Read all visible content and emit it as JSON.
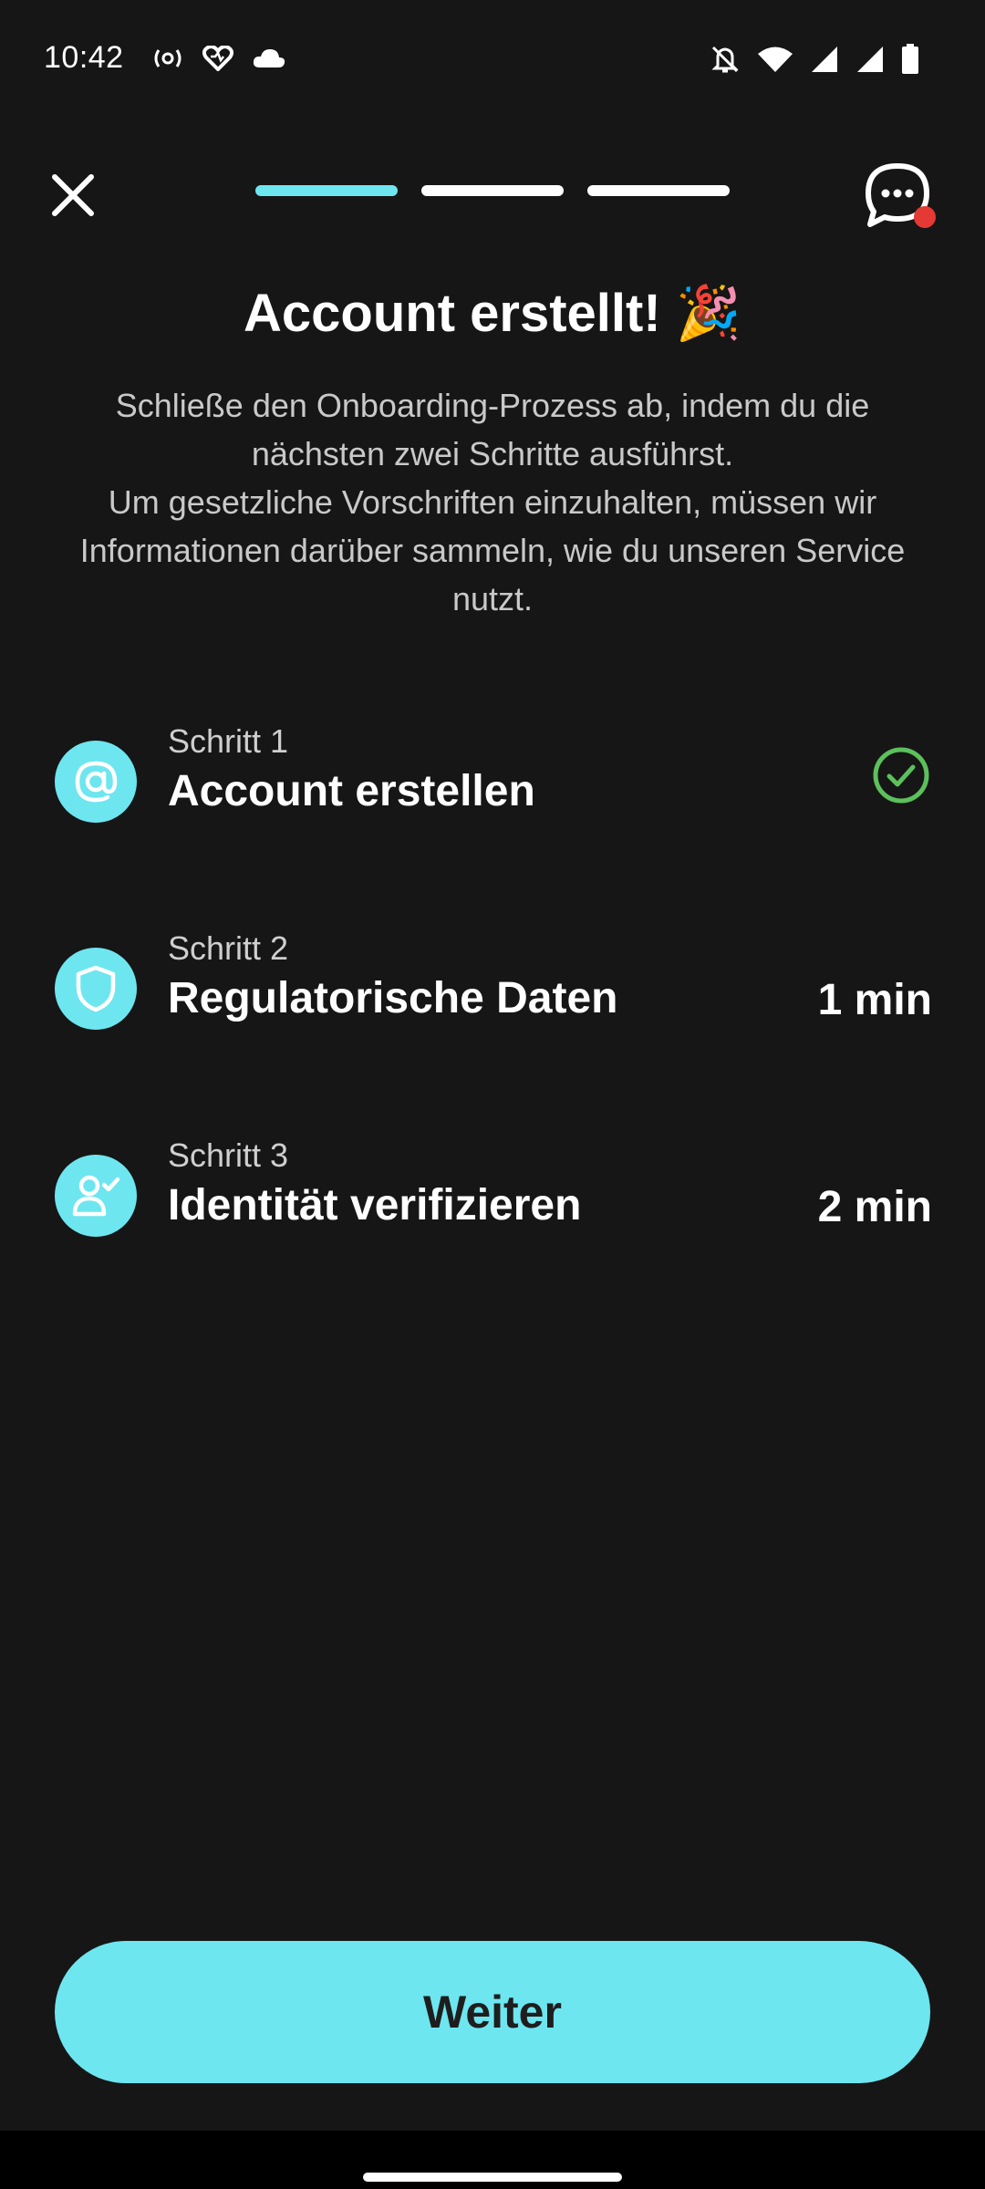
{
  "status_bar": {
    "time": "10:42",
    "left_icons": [
      "radio-icon",
      "heart-icon",
      "cloud-icon"
    ],
    "right_icons": [
      "bell-off-icon",
      "wifi-icon",
      "signal-icon",
      "signal-icon",
      "battery-icon"
    ]
  },
  "header": {
    "progress": {
      "total_steps": 3,
      "active_step": 1
    },
    "close_icon": "close-icon",
    "chat_icon": "chat-icon",
    "chat_notification": true
  },
  "main": {
    "title": "Account erstellt! 🎉",
    "description": [
      "Schließe den Onboarding-Prozess ab, indem du die nächsten zwei Schritte ausführst.",
      "Um gesetzliche Vorschriften einzuhalten, müssen wir Informationen darüber sammeln, wie du unseren Service nutzt."
    ],
    "steps": [
      {
        "label": "Schritt 1",
        "title": "Account erstellen",
        "icon": "at-icon",
        "completed": true,
        "time": ""
      },
      {
        "label": "Schritt 2",
        "title": "Regulatorische Daten",
        "icon": "shield-icon",
        "completed": false,
        "time": "1 min"
      },
      {
        "label": "Schritt 3",
        "title": "Identität verifizieren",
        "icon": "user-check-icon",
        "completed": false,
        "time": "2 min"
      }
    ]
  },
  "footer": {
    "continue_label": "Weiter"
  },
  "colors": {
    "accent": "#6de6f0",
    "background": "#161616",
    "success": "#5cc05c",
    "notification": "#e53935"
  }
}
